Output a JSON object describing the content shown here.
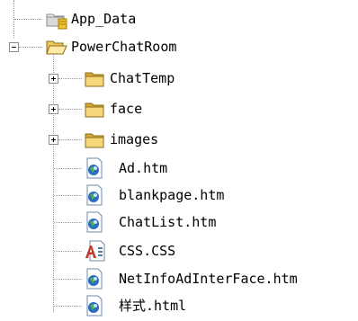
{
  "tree": {
    "items": [
      {
        "label": "App_Data",
        "icon": "special-folder-icon",
        "state": "leaf"
      },
      {
        "label": "PowerChatRoom",
        "icon": "open-folder-icon",
        "state": "expanded"
      },
      {
        "label": "ChatTemp",
        "icon": "folder-icon",
        "state": "collapsed"
      },
      {
        "label": "face",
        "icon": "folder-icon",
        "state": "collapsed"
      },
      {
        "label": "images",
        "icon": "folder-icon",
        "state": "collapsed"
      },
      {
        "label": "Ad.htm",
        "icon": "html-file-icon",
        "state": "leaf"
      },
      {
        "label": "blankpage.htm",
        "icon": "html-file-icon",
        "state": "leaf"
      },
      {
        "label": "ChatList.htm",
        "icon": "html-file-icon",
        "state": "leaf"
      },
      {
        "label": "CSS.CSS",
        "icon": "css-file-icon",
        "state": "leaf"
      },
      {
        "label": "NetInfoAdInterFace.htm",
        "icon": "html-file-icon",
        "state": "leaf"
      },
      {
        "label": "样式.html",
        "icon": "html-file-icon",
        "state": "leaf"
      }
    ]
  },
  "colors": {
    "folder_yellow": "#f6d77a",
    "folder_dark": "#d4a833",
    "globe_blue": "#2a6ebf",
    "page_border": "#6f8aa8"
  }
}
